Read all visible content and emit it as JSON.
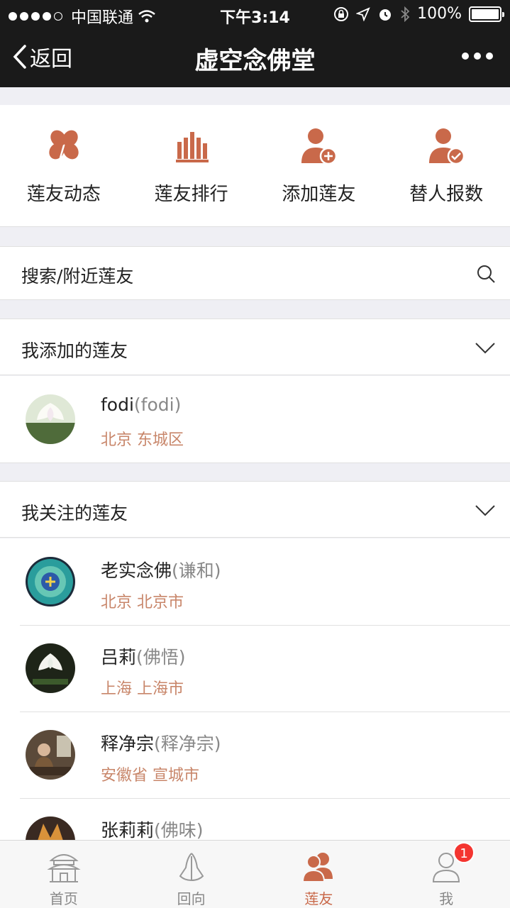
{
  "status_bar": {
    "carrier": "中国联通",
    "time": "下午3:14",
    "battery": "100%",
    "battery_level": 1.0
  },
  "nav": {
    "back_label": "返回",
    "title": "虚空念佛堂"
  },
  "shortcuts": [
    {
      "label": "莲友动态",
      "icon": "clover-icon"
    },
    {
      "label": "莲友排行",
      "icon": "bar-chart-icon"
    },
    {
      "label": "添加莲友",
      "icon": "add-user-icon"
    },
    {
      "label": "替人报数",
      "icon": "user-check-icon"
    }
  ],
  "search": {
    "label": "搜索/附近莲友"
  },
  "added_section": {
    "title": "我添加的莲友",
    "friends": [
      {
        "name": "fodi",
        "nick": "(fodi)",
        "location": "北京 东城区"
      }
    ]
  },
  "followed_section": {
    "title": "我关注的莲友",
    "friends": [
      {
        "name": "老实念佛",
        "nick": "(谦和)",
        "location": "北京 北京市"
      },
      {
        "name": "吕莉",
        "nick": "(佛悟)",
        "location": "上海 上海市"
      },
      {
        "name": "释净宗",
        "nick": "(释净宗)",
        "location": "安徽省 宣城市"
      },
      {
        "name": "张莉莉",
        "nick": "(佛味)",
        "location": ""
      }
    ]
  },
  "tabbar": {
    "tabs": [
      {
        "label": "首页",
        "icon": "temple-icon"
      },
      {
        "label": "回向",
        "icon": "praying-hands-icon"
      },
      {
        "label": "莲友",
        "icon": "friends-icon"
      },
      {
        "label": "我",
        "icon": "profile-icon"
      }
    ],
    "active_index": 2,
    "me_badge": "1"
  },
  "colors": {
    "accent": "#c9694a",
    "location_text": "#c8866a",
    "header_bg": "#1a1a1a",
    "badge": "#f43530"
  }
}
